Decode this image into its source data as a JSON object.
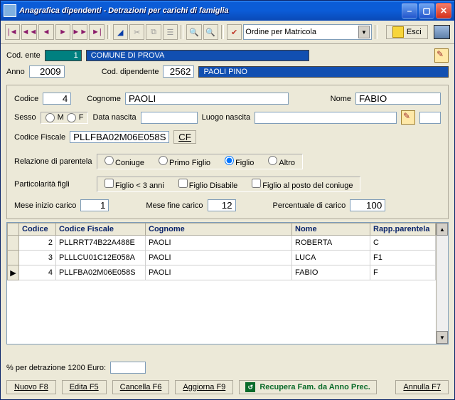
{
  "window": {
    "title": "Anagrafica dipendenti - Detrazioni per carichi di famiglia"
  },
  "toolbar": {
    "ordine_label": "Ordine per Matricola",
    "esci": "Esci"
  },
  "header": {
    "cod_ente_label": "Cod. ente",
    "cod_ente_value": "1",
    "ente_name": "COMUNE DI PROVA",
    "anno_label": "Anno",
    "anno_value": "2009",
    "cod_dip_label": "Cod. dipendente",
    "cod_dip_value": "2562",
    "dip_name": "PAOLI PINO"
  },
  "detail": {
    "codice_label": "Codice",
    "codice_value": "4",
    "cognome_label": "Cognome",
    "cognome_value": "PAOLI",
    "nome_label": "Nome",
    "nome_value": "FABIO",
    "sesso_label": "Sesso",
    "sesso_m": "M",
    "sesso_f": "F",
    "data_nascita_label": "Data nascita",
    "data_nascita_value": "",
    "luogo_nascita_label": "Luogo nascita",
    "luogo_nascita_value": "",
    "cf_label": "Codice Fiscale",
    "cf_value": "PLLFBA02M06E058S",
    "cf_btn": "CF",
    "rel_label": "Relazione di parentela",
    "rel_coniuge": "Coniuge",
    "rel_primo": "Primo Figlio",
    "rel_figlio": "Figlio",
    "rel_altro": "Altro",
    "part_label": "Particolarità figli",
    "part_lt3": "Figlio < 3 anni",
    "part_disab": "Figlio Disabile",
    "part_posto": "Figlio al posto del coniuge",
    "mese_inizio_label": "Mese inizio carico",
    "mese_inizio_value": "1",
    "mese_fine_label": "Mese fine carico",
    "mese_fine_value": "12",
    "perc_label": "Percentuale  di carico",
    "perc_value": "100"
  },
  "grid": {
    "cols": {
      "codice": "Codice",
      "cf": "Codice Fiscale",
      "cognome": "Cognome",
      "nome": "Nome",
      "rapp": "Rapp.parentela"
    },
    "rows": [
      {
        "codice": "2",
        "cf": "PLLRRT74B22A488E",
        "cognome": "PAOLI",
        "nome": "ROBERTA",
        "rapp": "C"
      },
      {
        "codice": "3",
        "cf": "PLLLCU01C12E058A",
        "cognome": "PAOLI",
        "nome": "LUCA",
        "rapp": "F1"
      },
      {
        "codice": "4",
        "cf": "PLLFBA02M06E058S",
        "cognome": "PAOLI",
        "nome": "FABIO",
        "rapp": "F"
      }
    ]
  },
  "footer": {
    "perc_1200_label": "% per detrazione 1200 Euro:",
    "perc_1200_value": "",
    "nuovo": "Nuovo F8",
    "edita": "Edita F5",
    "cancella": "Cancella F6",
    "aggiorna": "Aggiorna F9",
    "recupera": "Recupera Fam. da  Anno Prec.",
    "annulla": "Annulla F7"
  }
}
